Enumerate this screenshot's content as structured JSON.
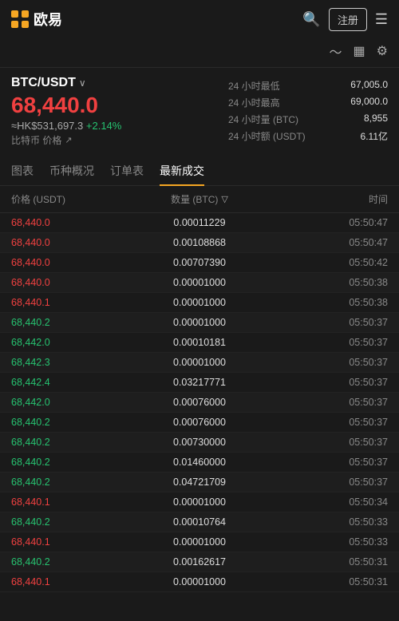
{
  "header": {
    "logo_text": "欧易",
    "register_label": "注册",
    "menu_icon": "☰"
  },
  "toolbar": {
    "chart_icon": "〜",
    "list_icon": "▦",
    "settings_icon": "⚙"
  },
  "trading_pair": {
    "name": "BTC/USDT",
    "main_price": "68,440.0",
    "hk_price": "≈HK$531,697.3",
    "change_pct": "+2.14%",
    "btc_label": "比特币 价格",
    "stats": [
      {
        "label": "24 小时最低",
        "value": "67,005.0"
      },
      {
        "label": "24 小时最高",
        "value": "69,000.0"
      },
      {
        "label": "24 小时量 (BTC)",
        "value": "8,955"
      },
      {
        "label": "24 小时额 (USDT)",
        "value": "6.11亿"
      }
    ]
  },
  "tabs": [
    {
      "id": "chart",
      "label": "图表"
    },
    {
      "id": "overview",
      "label": "币种概况"
    },
    {
      "id": "order",
      "label": "订单表"
    },
    {
      "id": "trades",
      "label": "最新成交",
      "active": true
    }
  ],
  "table": {
    "headers": {
      "price": "价格 (USDT)",
      "amount": "数量 (BTC)",
      "time": "时间"
    },
    "rows": [
      {
        "price": "68,440.0",
        "color": "red",
        "amount": "0.00011229",
        "time": "05:50:47"
      },
      {
        "price": "68,440.0",
        "color": "red",
        "amount": "0.00108868",
        "time": "05:50:47"
      },
      {
        "price": "68,440.0",
        "color": "red",
        "amount": "0.00707390",
        "time": "05:50:42"
      },
      {
        "price": "68,440.0",
        "color": "red",
        "amount": "0.00001000",
        "time": "05:50:38"
      },
      {
        "price": "68,440.1",
        "color": "red",
        "amount": "0.00001000",
        "time": "05:50:38"
      },
      {
        "price": "68,440.2",
        "color": "green",
        "amount": "0.00001000",
        "time": "05:50:37"
      },
      {
        "price": "68,442.0",
        "color": "green",
        "amount": "0.00010181",
        "time": "05:50:37"
      },
      {
        "price": "68,442.3",
        "color": "green",
        "amount": "0.00001000",
        "time": "05:50:37"
      },
      {
        "price": "68,442.4",
        "color": "green",
        "amount": "0.03217771",
        "time": "05:50:37"
      },
      {
        "price": "68,442.0",
        "color": "green",
        "amount": "0.00076000",
        "time": "05:50:37"
      },
      {
        "price": "68,440.2",
        "color": "green",
        "amount": "0.00076000",
        "time": "05:50:37"
      },
      {
        "price": "68,440.2",
        "color": "green",
        "amount": "0.00730000",
        "time": "05:50:37"
      },
      {
        "price": "68,440.2",
        "color": "green",
        "amount": "0.01460000",
        "time": "05:50:37"
      },
      {
        "price": "68,440.2",
        "color": "green",
        "amount": "0.04721709",
        "time": "05:50:37"
      },
      {
        "price": "68,440.1",
        "color": "red",
        "amount": "0.00001000",
        "time": "05:50:34"
      },
      {
        "price": "68,440.2",
        "color": "green",
        "amount": "0.00010764",
        "time": "05:50:33"
      },
      {
        "price": "68,440.1",
        "color": "red",
        "amount": "0.00001000",
        "time": "05:50:33"
      },
      {
        "price": "68,440.2",
        "color": "green",
        "amount": "0.00162617",
        "time": "05:50:31"
      },
      {
        "price": "68,440.1",
        "color": "red",
        "amount": "0.00001000",
        "time": "05:50:31"
      }
    ]
  }
}
